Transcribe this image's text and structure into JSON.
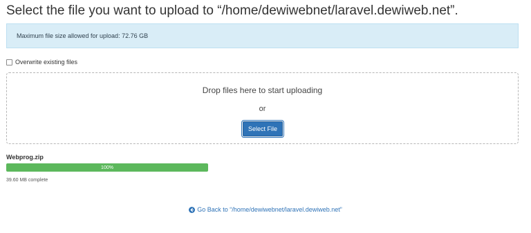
{
  "page": {
    "title": "Select the file you want to upload to “/home/dewiwebnet/laravel.dewiweb.net”."
  },
  "info": {
    "max_size_text": "Maximum file size allowed for upload: 72.76 GB"
  },
  "overwrite": {
    "label": "Overwrite existing files",
    "checked": false
  },
  "drop_zone": {
    "prompt": "Drop files here to start uploading",
    "or_text": "or",
    "select_button_label": "Select File"
  },
  "upload": {
    "file_name": "Webprog.zip",
    "progress_label": "100%",
    "progress_fraction": 1.0,
    "status_text": "39.60 MB complete"
  },
  "go_back": {
    "label": "Go Back to “/home/dewiwebnet/laravel.dewiweb.net”",
    "icon": "arrow-circle-left-icon"
  },
  "colors": {
    "accent": "#2f73b7",
    "info_background": "#d9edf7",
    "progress_fill": "#5cb85c"
  }
}
